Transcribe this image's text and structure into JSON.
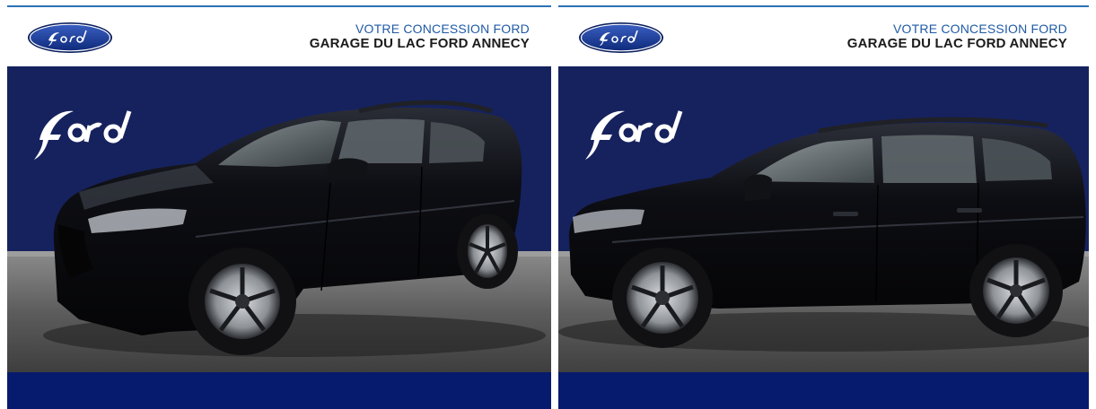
{
  "colors": {
    "accent_line": "#2a72b5",
    "dealer_label": "#1f5aa6",
    "banner_navy": "#16225e",
    "footer_navy": "#061a6e",
    "car_body": "#0b0c10"
  },
  "icons": {
    "brand_oval": "ford-oval-logo-icon",
    "brand_script": "ford-script-logo-icon"
  },
  "cards": [
    {
      "view": "three-quarter front",
      "dealer_line1": "VOTRE CONCESSION FORD",
      "dealer_line2": "GARAGE DU LAC FORD ANNECY"
    },
    {
      "view": "side profile",
      "dealer_line1": "VOTRE CONCESSION FORD",
      "dealer_line2": "GARAGE DU LAC FORD ANNECY"
    }
  ]
}
